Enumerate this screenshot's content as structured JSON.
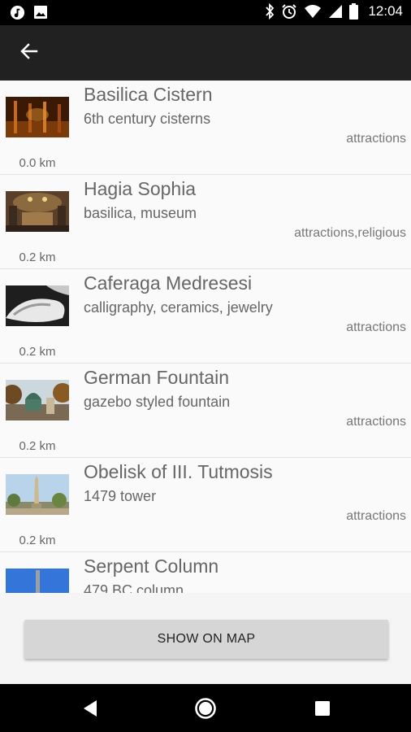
{
  "status_bar": {
    "time": "12:04",
    "left_icons": [
      "music-app-icon",
      "image-icon"
    ],
    "right_icons": [
      "bluetooth-icon",
      "alarm-icon",
      "wifi-icon",
      "cell-signal-icon",
      "battery-icon"
    ]
  },
  "app_bar": {
    "back_icon": "arrow-back-icon"
  },
  "places": [
    {
      "name": "Basilica Cistern",
      "description": "6th century cisterns",
      "categories": "attractions",
      "distance": "0.0 km"
    },
    {
      "name": "Hagia Sophia",
      "description": "basilica, museum",
      "categories": "attractions,religious",
      "distance": "0.2 km"
    },
    {
      "name": "Caferaga Medresesi",
      "description": "calligraphy, ceramics, jewelry",
      "categories": "attractions",
      "distance": "0.2 km"
    },
    {
      "name": "German Fountain",
      "description": "gazebo styled fountain",
      "categories": "attractions",
      "distance": "0.2 km"
    },
    {
      "name": "Obelisk of III. Tutmosis",
      "description": "1479 tower",
      "categories": "attractions",
      "distance": "0.2 km"
    },
    {
      "name": "Serpent Column",
      "description": "479 BC column",
      "categories": "",
      "distance": ""
    }
  ],
  "actions": {
    "show_on_map": "SHOW ON MAP"
  },
  "nav_bar": {
    "icons": [
      "nav-back-icon",
      "nav-home-icon",
      "nav-recents-icon"
    ]
  },
  "colors": {
    "status_bar": "#000000",
    "app_bar": "#212121",
    "list_background": "#fafafa",
    "button": "#d6d6d6",
    "text_primary": "#666666"
  }
}
